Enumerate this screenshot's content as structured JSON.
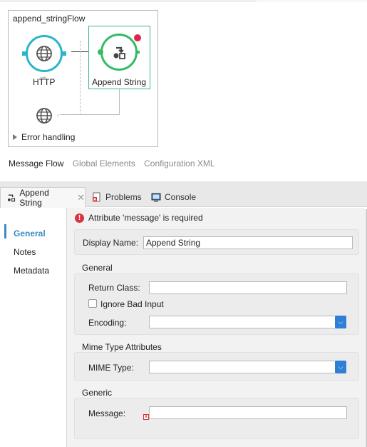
{
  "flow": {
    "title": "append_stringFlow",
    "http_label": "HTTP",
    "append_label": "Append String",
    "error_handling": "Error handling"
  },
  "editor_tabs": {
    "message_flow": "Message Flow",
    "global_elements": "Global Elements",
    "configuration_xml": "Configuration XML"
  },
  "view_tabs": {
    "append_string": "Append String",
    "problems": "Problems",
    "console": "Console"
  },
  "nav": {
    "general": "General",
    "notes": "Notes",
    "metadata": "Metadata"
  },
  "props": {
    "error_message": "Attribute 'message' is required",
    "display_name_label": "Display Name:",
    "display_name_value": "Append String",
    "general_title": "General",
    "return_class_label": "Return Class:",
    "return_class_value": "",
    "ignore_bad_input_label": "Ignore Bad Input",
    "ignore_bad_input_checked": false,
    "encoding_label": "Encoding:",
    "encoding_value": "",
    "mime_title": "Mime Type Attributes",
    "mime_type_label": "MIME Type:",
    "mime_type_value": "",
    "generic_title": "Generic",
    "message_label": "Message:",
    "message_value": ""
  },
  "colors": {
    "http_accent": "#29b6cc",
    "append_accent": "#33bb66",
    "error_red": "#d8343d",
    "combo_blue": "#2f7fd6",
    "selected_nav": "#3a8bc7"
  }
}
